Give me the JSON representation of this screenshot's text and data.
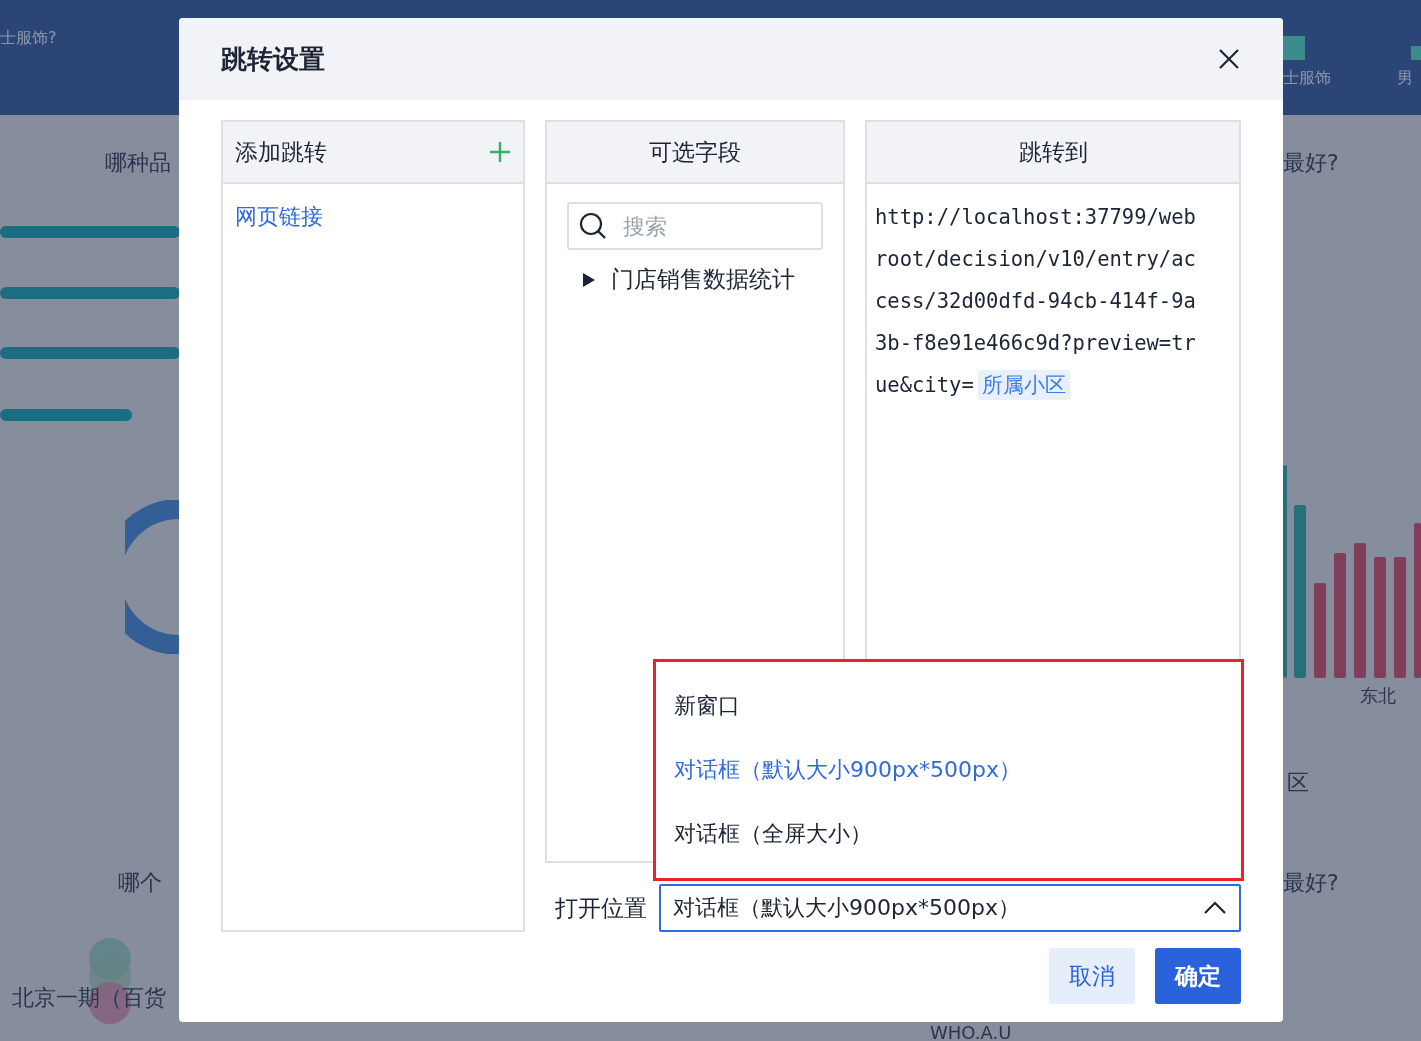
{
  "background": {
    "texts": [
      {
        "kind": "header",
        "text": "士服饰?"
      },
      {
        "kind": "header",
        "text": "士服饰"
      },
      {
        "kind": "header",
        "text": "男"
      },
      {
        "kind": "title",
        "text": "哪种品"
      },
      {
        "kind": "title",
        "text": "最好?"
      },
      {
        "kind": "axis",
        "text": "东北"
      },
      {
        "kind": "title",
        "text": "区"
      },
      {
        "kind": "title",
        "text": "哪个"
      },
      {
        "kind": "title",
        "text": "最好?"
      },
      {
        "kind": "title",
        "text": "北京一期（百货"
      },
      {
        "kind": "axis",
        "text": "WHO.A.U"
      }
    ]
  },
  "dialog": {
    "title": "跳转设置",
    "jumps": {
      "header": "添加跳转",
      "items": [
        {
          "label": "网页链接",
          "selected": true
        }
      ]
    },
    "fields": {
      "header": "可选字段",
      "search": {
        "placeholder": "搜索"
      },
      "tree": [
        {
          "label": "门店销售数据统计",
          "expanded": false
        }
      ]
    },
    "target": {
      "header": "跳转到",
      "url_lines": [
        "http://localhost:37799/web",
        "root/decision/v10/entry/ac",
        "cess/32d00dfd-94cb-414f-9a",
        "3b-f8e91e466c9d?preview=tr"
      ],
      "url_last": "ue&city=",
      "token": "所属小区"
    },
    "open_position": {
      "label": "打开位置",
      "value": "对话框（默认大小900px*500px）",
      "expanded": true,
      "options": [
        {
          "label": "新窗口",
          "selected": false
        },
        {
          "label": "对话框（默认大小900px*500px）",
          "selected": true
        },
        {
          "label": "对话框（全屏大小）",
          "selected": false
        }
      ]
    },
    "buttons": [
      {
        "kind": "secondary",
        "label": "取消"
      },
      {
        "kind": "primary",
        "label": "确定"
      }
    ]
  }
}
